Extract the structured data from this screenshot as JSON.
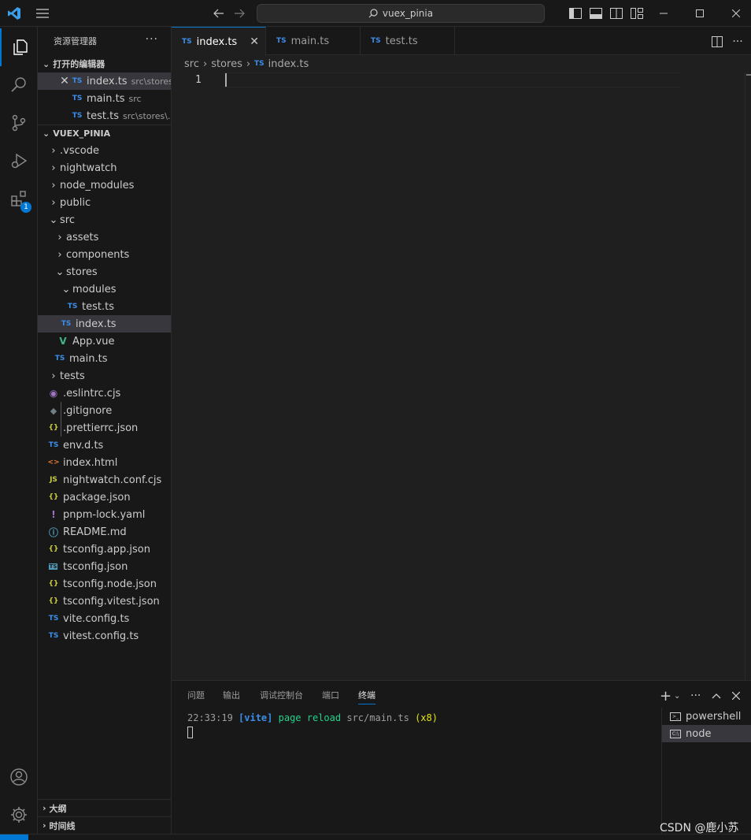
{
  "titlebar": {
    "search_text": "vuex_pinia"
  },
  "activitybar": {
    "extensions_badge": "1"
  },
  "sidebar": {
    "title": "资源管理器",
    "open_editors_label": "打开的编辑器",
    "open_editors": [
      {
        "name": "index.ts",
        "desc": "src\\stores",
        "icon": "TS"
      },
      {
        "name": "main.ts",
        "desc": "src",
        "icon": "TS"
      },
      {
        "name": "test.ts",
        "desc": "src\\stores\\...",
        "icon": "TS"
      }
    ],
    "project_label": "VUEX_PINIA",
    "tree": [
      {
        "name": ".vscode"
      },
      {
        "name": "nightwatch"
      },
      {
        "name": "node_modules"
      },
      {
        "name": "public"
      },
      {
        "name": "src"
      },
      {
        "name": "assets"
      },
      {
        "name": "components"
      },
      {
        "name": "stores"
      },
      {
        "name": "modules"
      },
      {
        "name": "test.ts",
        "icon": "TS"
      },
      {
        "name": "index.ts",
        "icon": "TS"
      },
      {
        "name": "App.vue",
        "icon": "V"
      },
      {
        "name": "main.ts",
        "icon": "TS"
      },
      {
        "name": "tests"
      },
      {
        "name": ".eslintrc.cjs",
        "icon": "◉"
      },
      {
        "name": ".gitignore",
        "icon": "◆"
      },
      {
        "name": ".prettierrc.json",
        "icon": "{}"
      },
      {
        "name": "env.d.ts",
        "icon": "TS"
      },
      {
        "name": "index.html",
        "icon": "<>"
      },
      {
        "name": "nightwatch.conf.cjs",
        "icon": "JS"
      },
      {
        "name": "package.json",
        "icon": "{}"
      },
      {
        "name": "pnpm-lock.yaml",
        "icon": "!"
      },
      {
        "name": "README.md",
        "icon": "ⓘ"
      },
      {
        "name": "tsconfig.app.json",
        "icon": "{}"
      },
      {
        "name": "tsconfig.json",
        "icon": "TS"
      },
      {
        "name": "tsconfig.node.json",
        "icon": "{}"
      },
      {
        "name": "tsconfig.vitest.json",
        "icon": "{}"
      },
      {
        "name": "vite.config.ts",
        "icon": "TS"
      },
      {
        "name": "vitest.config.ts",
        "icon": "TS"
      }
    ],
    "outline_label": "大纲",
    "timeline_label": "时间线"
  },
  "tabs": [
    {
      "name": "index.ts",
      "icon": "TS"
    },
    {
      "name": "main.ts",
      "icon": "TS"
    },
    {
      "name": "test.ts",
      "icon": "TS"
    }
  ],
  "breadcrumb": {
    "parts": [
      "src",
      "stores",
      "index.ts"
    ],
    "file_icon": "TS"
  },
  "editor": {
    "line_number": "1"
  },
  "panel": {
    "tabs": [
      "问题",
      "输出",
      "调试控制台",
      "端口",
      "终端"
    ],
    "terminal": {
      "time": "22:33:19",
      "tag": "[vite]",
      "message": "page reload",
      "path": "src/main.ts",
      "count": "(x8)"
    },
    "terminals": [
      "powershell",
      "node"
    ]
  },
  "watermark": "CSDN @鹿小苏",
  "colors": {
    "accent": "#0078d4",
    "ts_icon": "#3b8eea",
    "json_icon": "#cbcb41",
    "vite_tag": "#3b8eea",
    "message": "#23d18b",
    "count": "#e5e510"
  }
}
